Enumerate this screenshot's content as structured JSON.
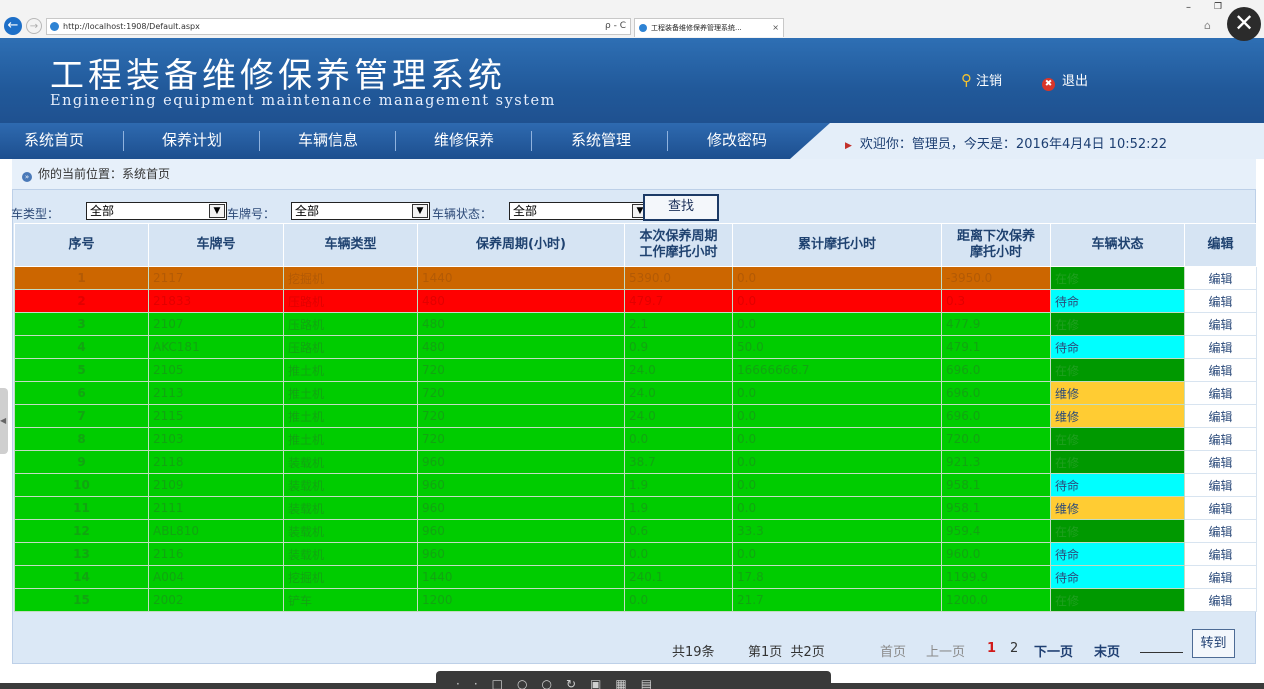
{
  "browser": {
    "url": "http://localhost:1908/Default.aspx",
    "tools": "ρ - C",
    "tab_title": "工程装备维修保养管理系统...",
    "tab_close": "×",
    "back": "←",
    "forward": "→",
    "min": "–",
    "max": "❐",
    "home": "⌂",
    "overlay_close": "✕"
  },
  "header": {
    "title": "工程装备维修保养管理系统",
    "subtitle": "Engineering equipment maintenance management system",
    "logout": "注销",
    "exit": "退出"
  },
  "menu": {
    "items": [
      "系统首页",
      "保养计划",
      "车辆信息",
      "维修保养",
      "系统管理",
      "修改密码"
    ]
  },
  "welcome": "欢迎你：管理员，今天是：2016年4月4日 10:52:22",
  "breadcrumb": "你的当前位置：系统首页",
  "filters": {
    "type_label": "车类型：",
    "type_value": "全部",
    "plate_label": "车牌号：",
    "plate_value": "全部",
    "status_label": "车辆状态：",
    "status_value": "全部",
    "search": "查找"
  },
  "table": {
    "headers": [
      "序号",
      "车牌号",
      "车辆类型",
      "保养周期(小时)",
      "本次保养周期\n工作摩托小时",
      "累计摩托小时",
      "距离下次保养\n摩托小时",
      "车辆状态",
      "编辑"
    ],
    "edit_label": "编辑",
    "rows": [
      {
        "idx": "1",
        "plate": "2117",
        "type": "挖掘机",
        "cycle": "1440",
        "current": "5390.0",
        "total": "0.0",
        "next": "-3950.0",
        "status": "在修",
        "row_color": "orange",
        "status_color": "#009900"
      },
      {
        "idx": "2",
        "plate": "21833",
        "type": "压路机",
        "cycle": "480",
        "current": "479.7",
        "total": "0.0",
        "next": "0.3",
        "status": "待命",
        "row_color": "red",
        "status_color": "#00ffff"
      },
      {
        "idx": "3",
        "plate": "2107",
        "type": "压路机",
        "cycle": "480",
        "current": "2.1",
        "total": "0.0",
        "next": "477.9",
        "status": "在修",
        "row_color": "green",
        "status_color": "#009900"
      },
      {
        "idx": "4",
        "plate": "AKC181",
        "type": "压路机",
        "cycle": "480",
        "current": "0.9",
        "total": "50.0",
        "next": "479.1",
        "status": "待命",
        "row_color": "green",
        "status_color": "#00ffff"
      },
      {
        "idx": "5",
        "plate": "2105",
        "type": "推土机",
        "cycle": "720",
        "current": "24.0",
        "total": "16666666.7",
        "next": "696.0",
        "status": "在修",
        "row_color": "green",
        "status_color": "#009900"
      },
      {
        "idx": "6",
        "plate": "2113",
        "type": "推土机",
        "cycle": "720",
        "current": "24.0",
        "total": "0.0",
        "next": "696.0",
        "status": "维修",
        "row_color": "green",
        "status_color": "#ffcc33"
      },
      {
        "idx": "7",
        "plate": "2115",
        "type": "推土机",
        "cycle": "720",
        "current": "24.0",
        "total": "0.0",
        "next": "696.0",
        "status": "维修",
        "row_color": "green",
        "status_color": "#ffcc33"
      },
      {
        "idx": "8",
        "plate": "2103",
        "type": "推土机",
        "cycle": "720",
        "current": "0.0",
        "total": "0.0",
        "next": "720.0",
        "status": "在修",
        "row_color": "green",
        "status_color": "#009900"
      },
      {
        "idx": "9",
        "plate": "2118",
        "type": "装载机",
        "cycle": "960",
        "current": "38.7",
        "total": "0.0",
        "next": "921.3",
        "status": "在修",
        "row_color": "green",
        "status_color": "#009900"
      },
      {
        "idx": "10",
        "plate": "2109",
        "type": "装载机",
        "cycle": "960",
        "current": "1.9",
        "total": "0.0",
        "next": "958.1",
        "status": "待命",
        "row_color": "green",
        "status_color": "#00ffff"
      },
      {
        "idx": "11",
        "plate": "2111",
        "type": "装载机",
        "cycle": "960",
        "current": "1.9",
        "total": "0.0",
        "next": "958.1",
        "status": "维修",
        "row_color": "green",
        "status_color": "#ffcc33"
      },
      {
        "idx": "12",
        "plate": "ABL810",
        "type": "装载机",
        "cycle": "960",
        "current": "0.6",
        "total": "33.3",
        "next": "959.4",
        "status": "在修",
        "row_color": "green",
        "status_color": "#009900"
      },
      {
        "idx": "13",
        "plate": "2116",
        "type": "装载机",
        "cycle": "960",
        "current": "0.0",
        "total": "0.0",
        "next": "960.0",
        "status": "待命",
        "row_color": "green",
        "status_color": "#00ffff"
      },
      {
        "idx": "14",
        "plate": "A004",
        "type": "挖掘机",
        "cycle": "1440",
        "current": "240.1",
        "total": "17.8",
        "next": "1199.9",
        "status": "待命",
        "row_color": "green",
        "status_color": "#00ffff"
      },
      {
        "idx": "15",
        "plate": "2002",
        "type": "铲车",
        "cycle": "1200",
        "current": "0.0",
        "total": "21.7",
        "next": "1200.0",
        "status": "在修",
        "row_color": "green",
        "status_color": "#009900"
      }
    ]
  },
  "pager": {
    "total": "共19条",
    "page_info": "第1页  共2页",
    "first": "首页",
    "prev": "上一页",
    "page1": "1",
    "page2": "2",
    "next": "下一页",
    "last": "末页",
    "goto": "转到"
  },
  "colors": {
    "header_blue": "#21599a",
    "row_green": "#00cc00",
    "row_orange": "#cc6600",
    "row_red": "#ff0000"
  }
}
